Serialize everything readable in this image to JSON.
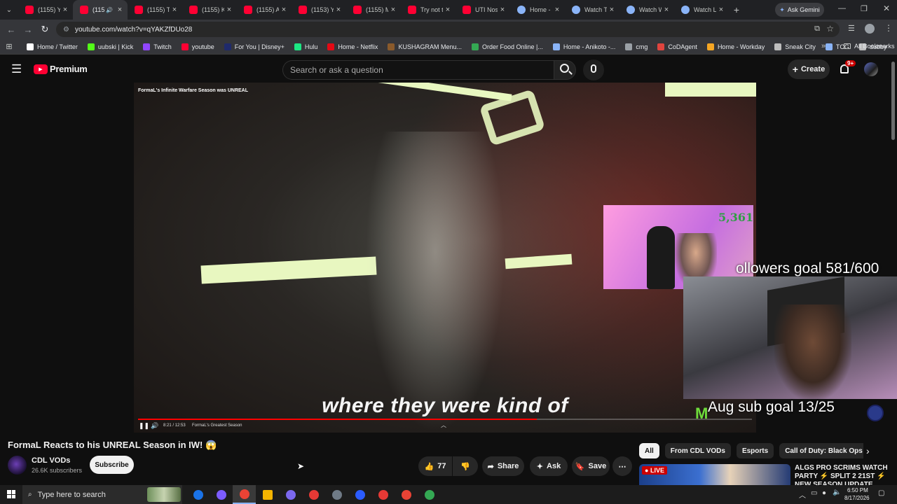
{
  "browser": {
    "tabs": [
      {
        "title": "(1155) Y",
        "icon": "youtube"
      },
      {
        "title": "(115",
        "icon": "youtube",
        "active": true
      },
      {
        "title": "(1155) T",
        "icon": "youtube"
      },
      {
        "title": "(1155) K",
        "icon": "youtube"
      },
      {
        "title": "(1155) A",
        "icon": "youtube"
      },
      {
        "title": "(1153) Y",
        "icon": "youtube"
      },
      {
        "title": "(1155) M",
        "icon": "youtube"
      },
      {
        "title": "Try not t",
        "icon": "youtube"
      },
      {
        "title": "UTI Nos",
        "icon": "youtube"
      },
      {
        "title": "Home -",
        "icon": "globe"
      },
      {
        "title": "Watch T",
        "icon": "globe"
      },
      {
        "title": "Watch W",
        "icon": "globe"
      },
      {
        "title": "Watch L",
        "icon": "globe"
      }
    ],
    "ask_gemini": "Ask Gemini",
    "url": "youtube.com/watch?v=qYAKZfDUo28",
    "bookmarks": [
      {
        "label": "Home / Twitter",
        "color": "#ffffff"
      },
      {
        "label": "uubski | Kick",
        "color": "#53fc18"
      },
      {
        "label": "Twitch",
        "color": "#9146ff"
      },
      {
        "label": "youtube",
        "color": "#ff0033"
      },
      {
        "label": "For You | Disney+",
        "color": "#1f2a6b"
      },
      {
        "label": "Hulu",
        "color": "#1ce783"
      },
      {
        "label": "Home - Netflix",
        "color": "#e50914"
      },
      {
        "label": "KUSHAGRAM Menu...",
        "color": "#8a5a2b"
      },
      {
        "label": "Order Food Online |...",
        "color": "#34a853"
      },
      {
        "label": "Home - Anikoto -...",
        "color": "#8ab4f8"
      },
      {
        "label": "cmg",
        "color": "#9aa0a6"
      },
      {
        "label": "CoDAgent",
        "color": "#e0443e"
      },
      {
        "label": "Home - Workday",
        "color": "#f5a623"
      },
      {
        "label": "Sneak City",
        "color": "#bdbdbd"
      },
      {
        "label": "TCG",
        "color": "#8ab4f8"
      },
      {
        "label": "dubby",
        "color": "#bdbdbd"
      }
    ],
    "all_bookmarks": "All Bookmarks",
    "more_bookmarks": "»"
  },
  "yt": {
    "logo_text": "Premium",
    "search_placeholder": "Search or ask a question",
    "create_label": "Create",
    "notif_count": "9+"
  },
  "video": {
    "overlay_title": "FormaL's Infinite Warfare Season was UNREAL",
    "caption": "where they were kind of",
    "time": "8:21 / 12:53",
    "chapter": "FormaL's Greatest Season",
    "progress": 0.65,
    "cam_viewer_count": "5,361",
    "followers_goal": "ollowers goal 581/600",
    "sub_goal": "Aug sub goal 13/25"
  },
  "meta": {
    "title": "FormaL Reacts to his UNREAL Season in IW! 😱",
    "channel": "CDL VODs",
    "subscribers": "26.6K subscribers",
    "subscribe_label": "Subscribe",
    "likes": "77",
    "share_label": "Share",
    "ask_label": "Ask",
    "save_label": "Save"
  },
  "chips": [
    {
      "label": "All",
      "active": true
    },
    {
      "label": "From CDL VODs"
    },
    {
      "label": "Esports"
    },
    {
      "label": "Call of Duty: Black Ops"
    },
    {
      "label": "Ca"
    }
  ],
  "related": {
    "live_badge": "LIVE",
    "title_line1": "ALGS PRO SCRIMS WATCH",
    "title_line2": "PARTY ⚡ SPLIT 2 21ST ⚡",
    "title_line3": "NEW SEASON UPDATE..."
  },
  "taskbar": {
    "search_placeholder": "Type here to search",
    "time": "6:50 PM",
    "date": "8/17/2026"
  }
}
